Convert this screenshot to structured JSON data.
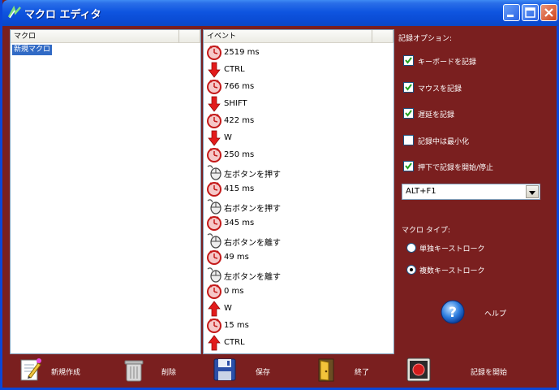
{
  "window": {
    "title": "マクロ エディタ"
  },
  "macro_list": {
    "header": "マクロ",
    "items": [
      "新規マクロ"
    ]
  },
  "event_list": {
    "header": "イベント",
    "events": [
      {
        "icon": "clock-icon",
        "label": "2519 ms"
      },
      {
        "icon": "key-down-arrow-icon",
        "label": "CTRL"
      },
      {
        "icon": "clock-icon",
        "label": "766 ms"
      },
      {
        "icon": "key-down-arrow-icon",
        "label": "SHIFT"
      },
      {
        "icon": "clock-icon",
        "label": "422 ms"
      },
      {
        "icon": "key-down-arrow-icon",
        "label": "W"
      },
      {
        "icon": "clock-icon",
        "label": "250 ms"
      },
      {
        "icon": "mouse-icon",
        "label": "左ボタンを押す"
      },
      {
        "icon": "clock-icon",
        "label": "415 ms"
      },
      {
        "icon": "mouse-icon",
        "label": "右ボタンを押す"
      },
      {
        "icon": "clock-icon",
        "label": "345 ms"
      },
      {
        "icon": "mouse-icon",
        "label": "右ボタンを離す"
      },
      {
        "icon": "clock-icon",
        "label": "49 ms"
      },
      {
        "icon": "mouse-icon",
        "label": "左ボタンを離す"
      },
      {
        "icon": "clock-icon",
        "label": "0 ms"
      },
      {
        "icon": "key-up-arrow-icon",
        "label": "W"
      },
      {
        "icon": "clock-icon",
        "label": "15 ms"
      },
      {
        "icon": "key-up-arrow-icon",
        "label": "CTRL"
      }
    ]
  },
  "record_options": {
    "header": "記録オプション:",
    "checkboxes": [
      {
        "label": "キーボードを記録",
        "checked": true
      },
      {
        "label": "マウスを記録",
        "checked": true
      },
      {
        "label": "遅延を記録",
        "checked": true
      },
      {
        "label": "記録中は最小化",
        "checked": false
      },
      {
        "label": "押下で記録を開始/停止",
        "checked": true
      }
    ],
    "hotkey": "ALT+F1"
  },
  "macro_type": {
    "header": "マクロ タイプ:",
    "options": [
      {
        "label": "単独キーストローク",
        "selected": false
      },
      {
        "label": "複数キーストローク",
        "selected": true
      }
    ]
  },
  "help": {
    "label": "ヘルプ"
  },
  "toolbar": {
    "new": "新規作成",
    "delete": "削除",
    "save": "保存",
    "exit": "終了",
    "record": "記録を開始"
  },
  "colors": {
    "background": "#7a1f1f",
    "titlebar": "#0a4bd4",
    "selection": "#316ac5"
  }
}
